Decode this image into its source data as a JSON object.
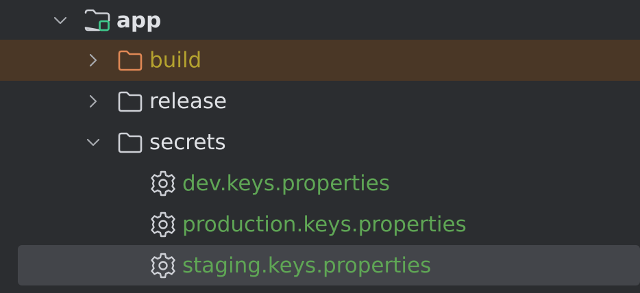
{
  "colors": {
    "background": "#2b2d30",
    "excluded_row": "#4a3726",
    "selected_row": "#43454a",
    "excluded_text": "#b5a32f",
    "file_text": "#5fa655",
    "folder_text": "#dfe1e5",
    "module_badge": "#3ec78b"
  },
  "tree": {
    "app": {
      "label": "app",
      "icon": "module-folder-icon",
      "expanded": true
    },
    "build": {
      "label": "build",
      "icon": "excluded-folder-icon",
      "expanded": false
    },
    "release": {
      "label": "release",
      "icon": "folder-icon",
      "expanded": false
    },
    "secrets": {
      "label": "secrets",
      "icon": "folder-icon",
      "expanded": true
    },
    "files": [
      {
        "label": "dev.keys.properties",
        "icon": "gear-icon"
      },
      {
        "label": "production.keys.properties",
        "icon": "gear-icon"
      },
      {
        "label": "staging.keys.properties",
        "icon": "gear-icon",
        "selected": true
      }
    ]
  }
}
